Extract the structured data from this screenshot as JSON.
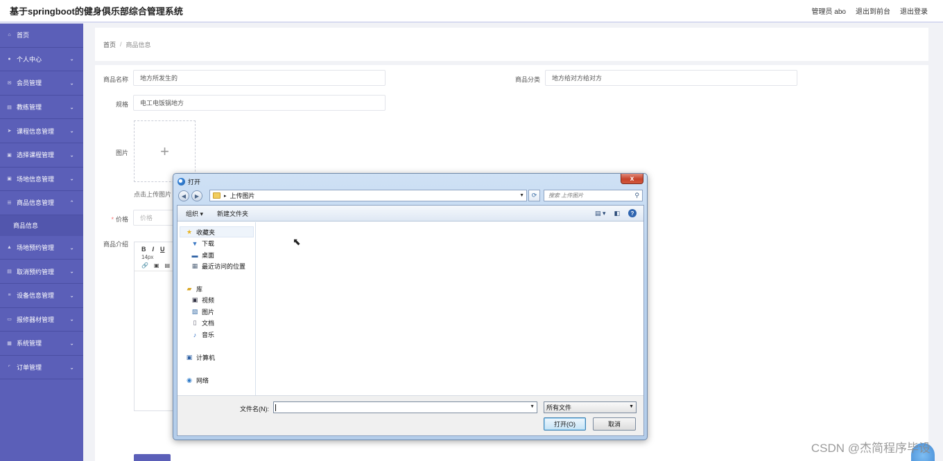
{
  "header": {
    "title": "基于springboot的健身俱乐部综合管理系统",
    "user": "管理员 abo",
    "front_link": "退出到前台",
    "logout": "退出登录"
  },
  "sidebar": {
    "items": [
      {
        "label": "首页",
        "icon": "home-icon"
      },
      {
        "label": "个人中心",
        "icon": "user-icon"
      },
      {
        "label": "会员管理",
        "icon": "mail-icon"
      },
      {
        "label": "教练管理",
        "icon": "list-icon"
      },
      {
        "label": "课程信息管理",
        "icon": "send-icon"
      },
      {
        "label": "选择课程管理",
        "icon": "doc-icon"
      },
      {
        "label": "场地信息管理",
        "icon": "doc-icon"
      },
      {
        "label": "商品信息管理",
        "icon": "list-icon"
      },
      {
        "label": "场地预约管理",
        "icon": "thumb-icon"
      },
      {
        "label": "取消预约管理",
        "icon": "list-icon"
      },
      {
        "label": "设备信息管理",
        "icon": "menu-icon"
      },
      {
        "label": "报修器材管理",
        "icon": "chat-icon"
      },
      {
        "label": "系统管理",
        "icon": "grid-icon"
      },
      {
        "label": "订单管理",
        "icon": "bracket-icon"
      }
    ],
    "sub_item": "商品信息"
  },
  "breadcrumb": {
    "home": "首页",
    "sep": "/",
    "current": "商品信息"
  },
  "form": {
    "name_label": "商品名称",
    "name_value": "地方所发生的",
    "category_label": "商品分类",
    "category_value": "地方给对方给对方",
    "spec_label": "规格",
    "spec_value": "电工电饭锅地方",
    "image_label": "图片",
    "upload_plus": "+",
    "upload_tip": "点击上传图片",
    "price_label": "价格",
    "price_placeholder": "价格",
    "required_mark": "*",
    "intro_label": "商品介绍",
    "editor_bold": "B",
    "editor_italic": "I",
    "editor_underline": "U",
    "editor_font_size": "14px"
  },
  "dialog": {
    "title": "打开",
    "close": "x",
    "path": "上传图片",
    "search_placeholder": "搜索 上传图片",
    "organize": "组织 ▾",
    "new_folder": "新建文件夹",
    "tree": {
      "favorites": "收藏夹",
      "downloads": "下载",
      "desktop": "桌面",
      "recent": "最近访问的位置",
      "libraries": "库",
      "videos": "视频",
      "pictures": "图片",
      "documents": "文档",
      "music": "音乐",
      "computer": "计算机",
      "network": "网络"
    },
    "filename_label": "文件名(N):",
    "filetype": "所有文件",
    "open_button": "打开(O)",
    "cancel_button": "取消"
  },
  "watermark": "CSDN @杰简程序毕设"
}
